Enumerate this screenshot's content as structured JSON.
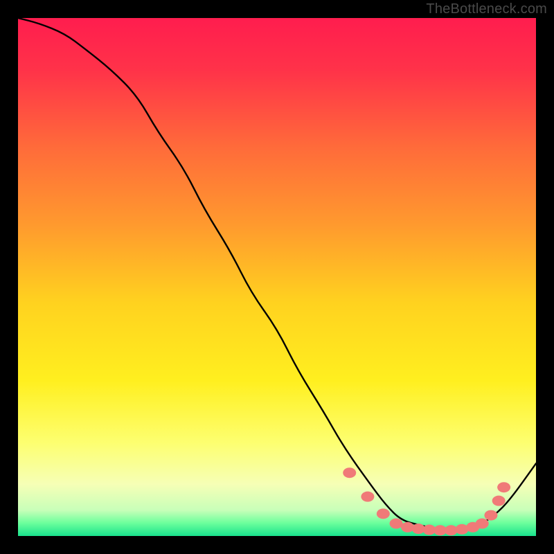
{
  "watermark": "TheBottleneck.com",
  "gradient": {
    "stops": [
      {
        "offset": 0.0,
        "color": "#ff1d4e"
      },
      {
        "offset": 0.1,
        "color": "#ff3249"
      },
      {
        "offset": 0.25,
        "color": "#ff6b3a"
      },
      {
        "offset": 0.4,
        "color": "#ff9a2e"
      },
      {
        "offset": 0.55,
        "color": "#ffd21f"
      },
      {
        "offset": 0.7,
        "color": "#ffef1f"
      },
      {
        "offset": 0.82,
        "color": "#fdff70"
      },
      {
        "offset": 0.9,
        "color": "#f6ffb6"
      },
      {
        "offset": 0.95,
        "color": "#c8ffb9"
      },
      {
        "offset": 0.975,
        "color": "#6cff9c"
      },
      {
        "offset": 1.0,
        "color": "#19e28d"
      }
    ]
  },
  "chart_data": {
    "type": "line",
    "title": "",
    "xlabel": "",
    "ylabel": "",
    "xlim": [
      0,
      100
    ],
    "ylim": [
      0,
      100
    ],
    "grid": false,
    "series": [
      {
        "name": "curve",
        "x": [
          0,
          4,
          9,
          13,
          18,
          23,
          27,
          32,
          36,
          41,
          45,
          50,
          54,
          59,
          63,
          68,
          71,
          74,
          78,
          82,
          86,
          89,
          92,
          95,
          100
        ],
        "y": [
          100,
          99,
          97,
          94,
          90,
          85,
          78,
          71,
          63,
          55,
          47,
          40,
          32,
          24,
          17,
          10,
          6,
          3,
          2,
          1,
          1,
          2,
          4,
          7,
          14
        ]
      }
    ],
    "markers": {
      "name": "dots",
      "color": "#f07a78",
      "points": [
        {
          "x": 64.0,
          "y": 12.2
        },
        {
          "x": 67.5,
          "y": 7.6
        },
        {
          "x": 70.5,
          "y": 4.3
        },
        {
          "x": 73.0,
          "y": 2.4
        },
        {
          "x": 75.2,
          "y": 1.7
        },
        {
          "x": 77.3,
          "y": 1.4
        },
        {
          "x": 79.4,
          "y": 1.2
        },
        {
          "x": 81.5,
          "y": 1.1
        },
        {
          "x": 83.6,
          "y": 1.1
        },
        {
          "x": 85.7,
          "y": 1.3
        },
        {
          "x": 87.8,
          "y": 1.7
        },
        {
          "x": 89.6,
          "y": 2.4
        },
        {
          "x": 91.3,
          "y": 4.0
        },
        {
          "x": 92.8,
          "y": 6.8
        },
        {
          "x": 93.8,
          "y": 9.4
        }
      ]
    }
  }
}
